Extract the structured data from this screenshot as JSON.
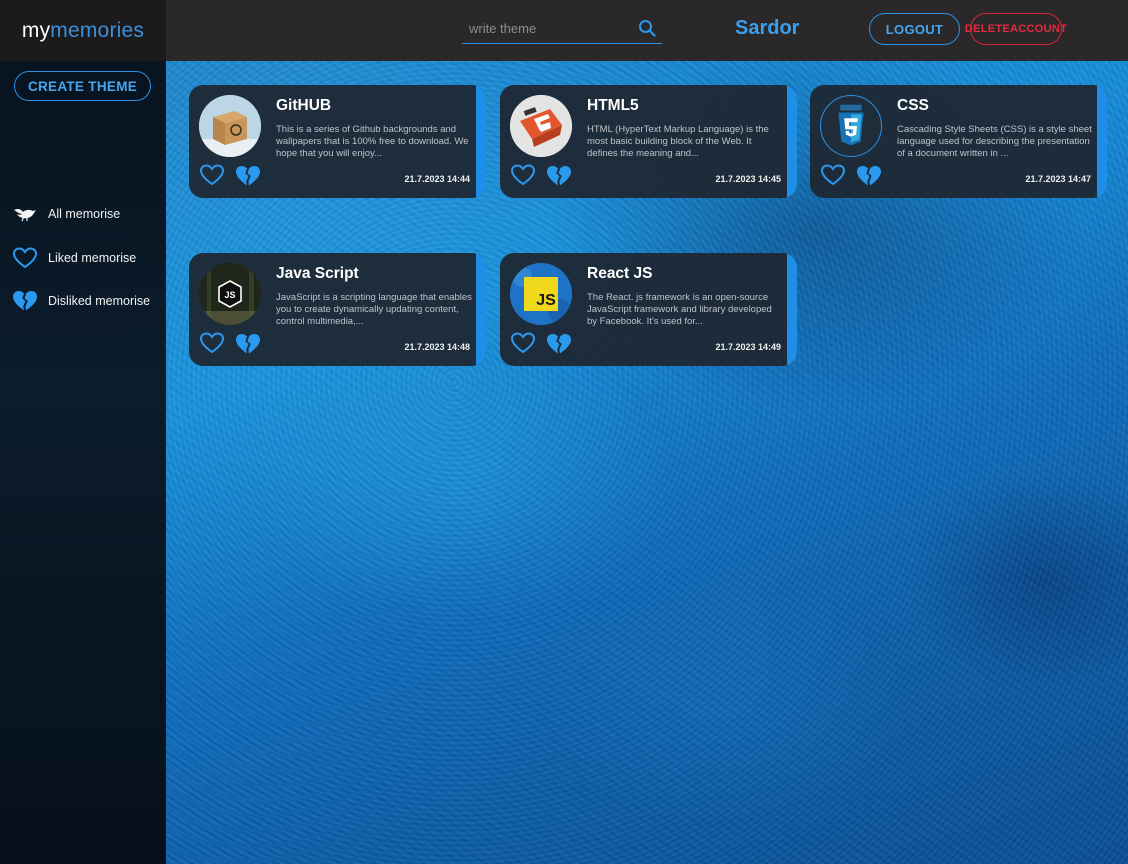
{
  "app": {
    "logo_part1": "my",
    "logo_part2": "memories"
  },
  "sidebar": {
    "create_label": "CREATE THEME",
    "items": [
      {
        "label": "All memorise",
        "icon": "bird-icon"
      },
      {
        "label": "Liked memorise",
        "icon": "heart-outline-icon"
      },
      {
        "label": "Disliked memorise",
        "icon": "broken-heart-icon"
      }
    ]
  },
  "header": {
    "search_placeholder": "write theme",
    "username": "Sardor",
    "logout_label": "LOGOUT",
    "delete_label_line1": "DELETE",
    "delete_label_line2": "ACCOUNT"
  },
  "colors": {
    "accent": "#2a92e6",
    "danger": "#d7263d",
    "card_bg": "#1e2630"
  },
  "cards": [
    {
      "title": "GitHUB",
      "description": "This is a series of Github backgrounds and wallpapers that is 100% free to download. We hope that you will enjoy...",
      "date": "21.7.2023 14:44",
      "image": "github-box-image"
    },
    {
      "title": "HTML5",
      "description": "HTML (HyperText Markup Language) is the most basic building block of the Web. It defines the meaning and...",
      "date": "21.7.2023 14:45",
      "image": "html5-logo-image"
    },
    {
      "title": "CSS",
      "description": "Cascading Style Sheets (CSS) is a style sheet language used for describing the presentation of a document written in ...",
      "date": "21.7.2023 14:47",
      "image": "css3-logo-image"
    },
    {
      "title": "Java Script",
      "description": "JavaScript is a scripting language that enables you to create dynamically updating content, control multimedia,...",
      "date": "21.7.2023 14:48",
      "image": "nodejs-logo-image"
    },
    {
      "title": "React JS",
      "description": "The React. js framework is an open-source JavaScript framework and library developed by Facebook. It's used for...",
      "date": "21.7.2023 14:49",
      "image": "js-logo-image"
    }
  ]
}
